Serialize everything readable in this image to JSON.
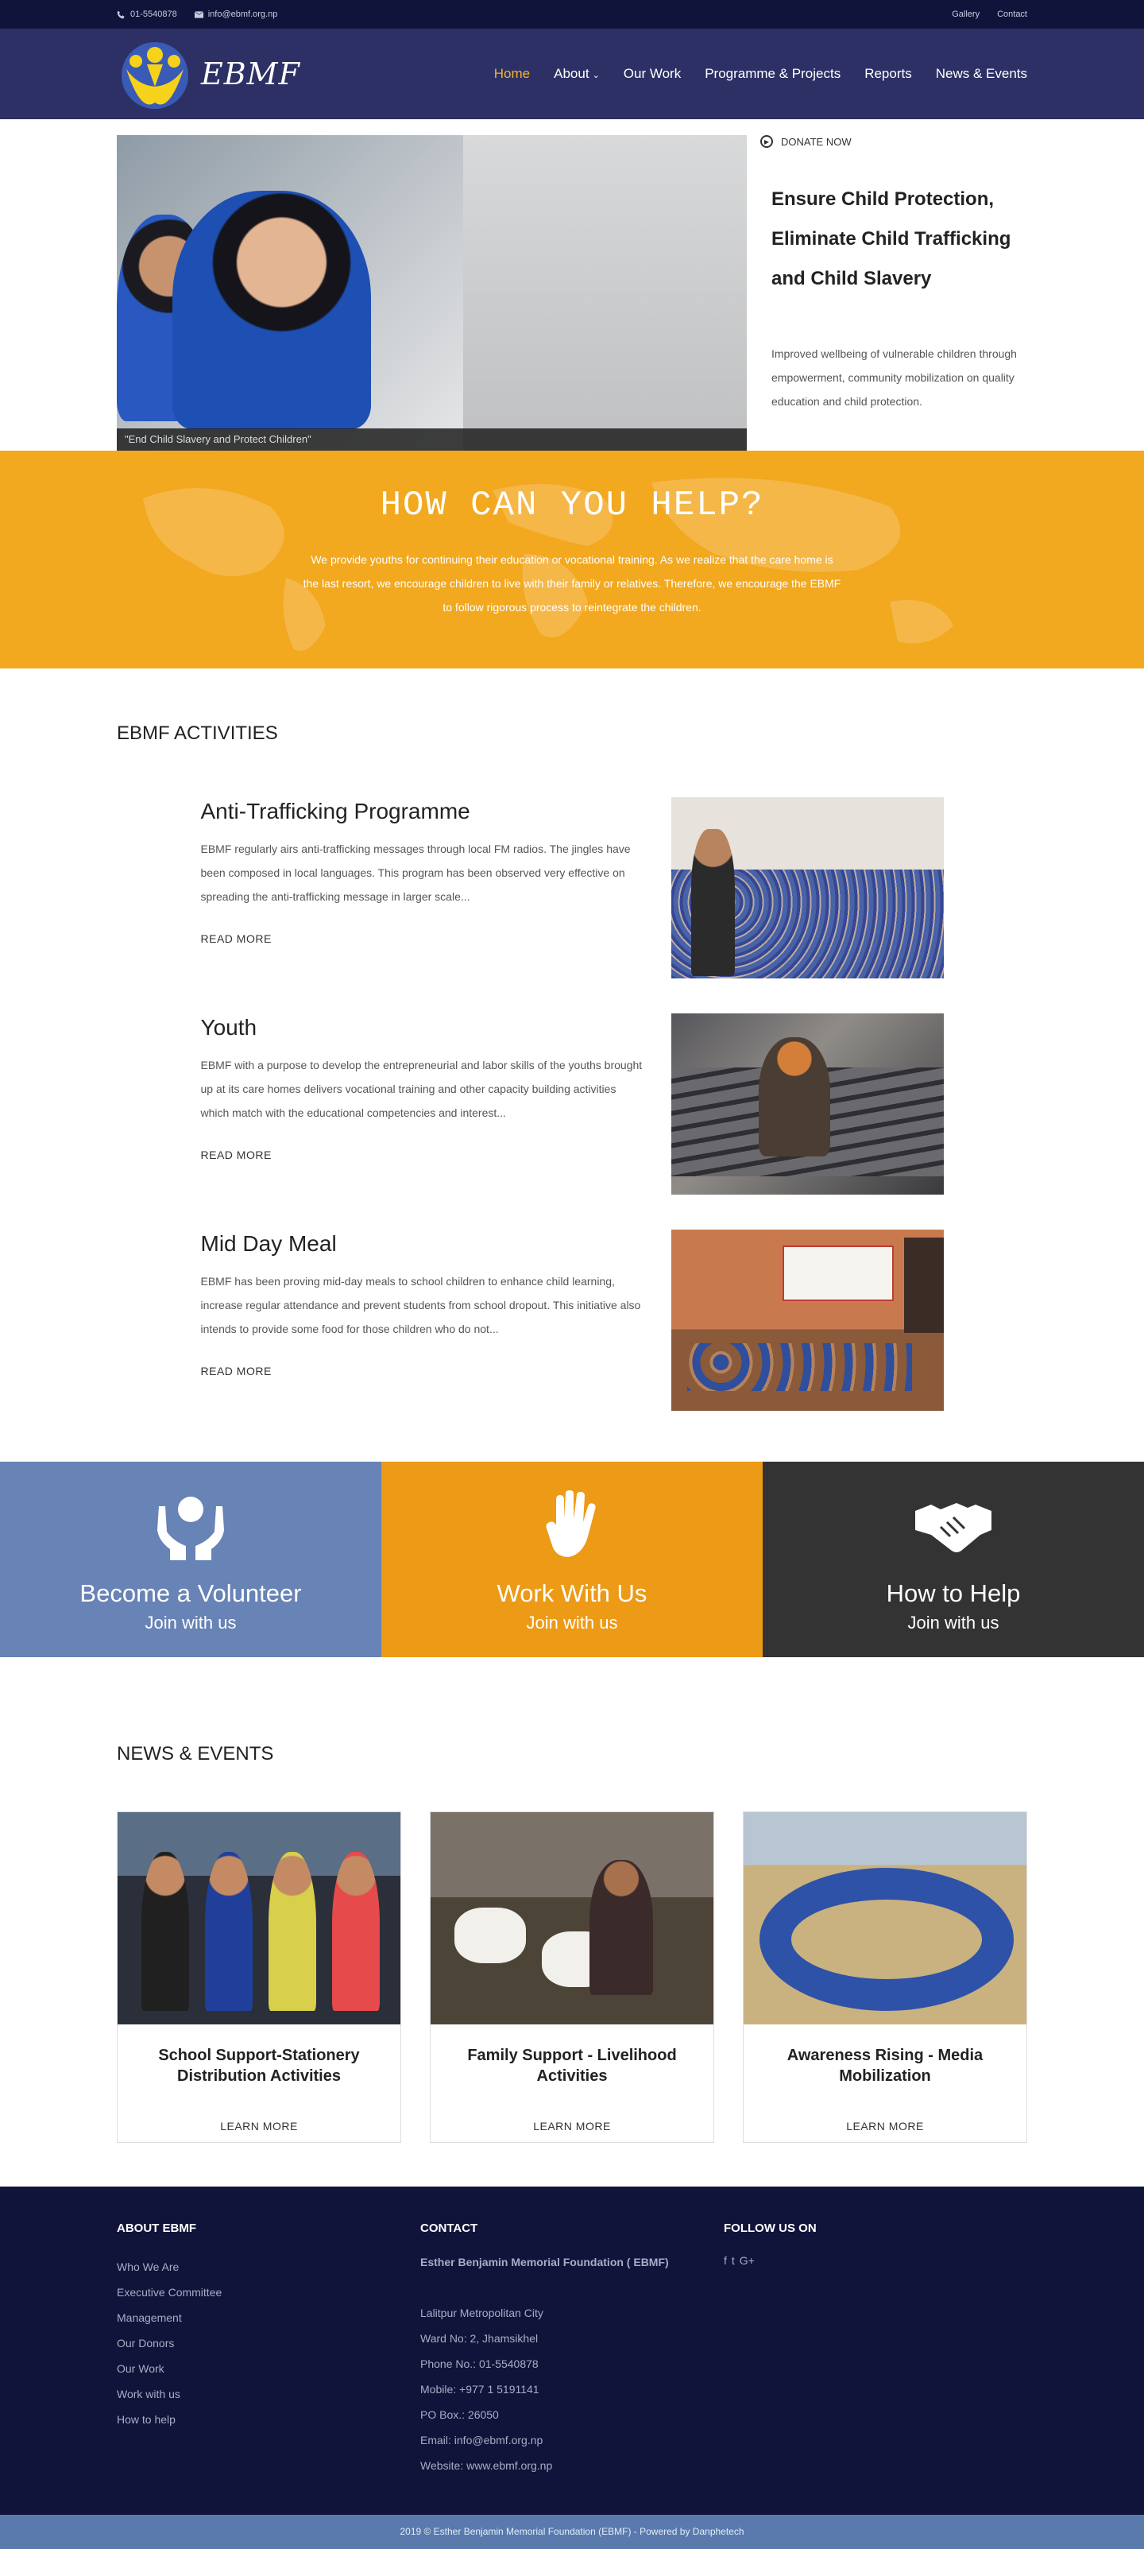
{
  "topbar": {
    "phone": "01-5540878",
    "email": "info@ebmf.org.np",
    "links": [
      "Gallery",
      "Contact"
    ]
  },
  "brand": {
    "name": "EBMF"
  },
  "nav": {
    "items": [
      {
        "label": "Home",
        "active": true
      },
      {
        "label": "About",
        "active": false
      },
      {
        "label": "Our Work",
        "active": false
      },
      {
        "label": "Programme & Projects",
        "active": false
      },
      {
        "label": "Reports",
        "active": false
      },
      {
        "label": "News & Events",
        "active": false
      }
    ],
    "caret": "⌄"
  },
  "hero": {
    "caption": "\"End Child Slavery and Protect Children\"",
    "donate_label": "DONATE NOW",
    "title": "Ensure Child Protection, Eliminate Child Trafficking and Child Slavery",
    "description": "Improved wellbeing of vulnerable children through empowerment, community mobilization on quality education and child protection."
  },
  "help": {
    "title": "HOW CAN YOU HELP?",
    "text": "We provide youths for continuing their education or vocational training. As we realize that the care home is the last resort, we encourage children to live with their family or relatives. Therefore, we encourage the EBMF to follow rigorous process to reintegrate the children."
  },
  "activities": {
    "heading": "EBMF ACTIVITIES",
    "items": [
      {
        "title": "Anti-Trafficking Programme",
        "text": "EBMF regularly airs anti-trafficking messages through local FM radios. The jingles have been composed in local languages. This program has been observed very effective on spreading the anti-trafficking message in larger scale...",
        "link": "READ MORE"
      },
      {
        "title": "Youth",
        "text": "EBMF with a purpose to develop the entrepreneurial and labor skills of the youths brought up at its care homes delivers vocational training and other capacity building activities which match with the educational competencies and interest...",
        "link": "READ MORE"
      },
      {
        "title": "Mid Day Meal",
        "text": "EBMF has been proving mid-day meals to school children to enhance child learning, increase regular attendance and prevent students from school dropout. This initiative also intends to provide some food for those children who do not...",
        "link": "READ MORE"
      }
    ]
  },
  "cta": [
    {
      "title": "Become a Volunteer",
      "sub": "Join with us",
      "icon": "hands-holding-heart-icon",
      "color": "#6883b5"
    },
    {
      "title": "Work With Us",
      "sub": "Join with us",
      "icon": "raised-hand-icon",
      "color": "#ed9a17"
    },
    {
      "title": "How to Help",
      "sub": "Join with us",
      "icon": "handshake-icon",
      "color": "#333333"
    }
  ],
  "news": {
    "heading": "NEWS & EVENTS",
    "items": [
      {
        "title": "School Support-Stationery Distribution Activities",
        "link": "LEARN MORE"
      },
      {
        "title": "Family Support - Livelihood Activities",
        "link": "LEARN MORE"
      },
      {
        "title": "Awareness Rising - Media Mobilization",
        "link": "LEARN MORE"
      }
    ]
  },
  "footer": {
    "about_heading": "ABOUT EBMF",
    "about_links": [
      "Who We Are",
      "Executive Committee",
      "Management",
      "Our Donors",
      "Our Work",
      "Work with us",
      "How to help"
    ],
    "contact_heading": "CONTACT",
    "org_name": "Esther Benjamin Memorial Foundation ( EBMF)",
    "contact_lines": [
      "Lalitpur Metropolitan City",
      "Ward No: 2, Jhamsikhel",
      "Phone No.: 01-5540878",
      "Mobile: +977 1 5191141",
      "PO Box.: 26050",
      "Email: info@ebmf.org.np",
      "Website: www.ebmf.org.np"
    ],
    "follow_heading": "FOLLOW US ON",
    "social": [
      "f",
      "t",
      "G+"
    ],
    "copyright": "2019 © Esther Benjamin Memorial Foundation (EBMF) - Powered by Danphetech"
  }
}
